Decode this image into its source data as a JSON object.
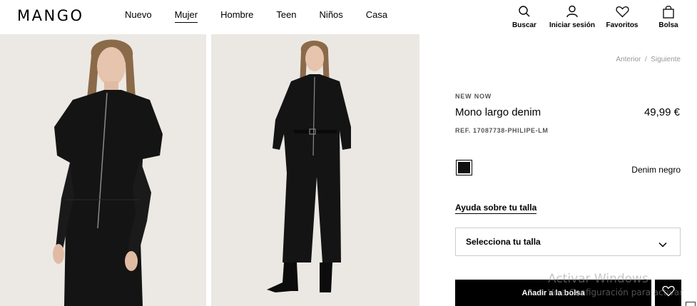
{
  "brand": {
    "logo": "MANGO"
  },
  "nav": {
    "items": [
      {
        "label": "Nuevo"
      },
      {
        "label": "Mujer",
        "active": true
      },
      {
        "label": "Hombre"
      },
      {
        "label": "Teen"
      },
      {
        "label": "Niños"
      },
      {
        "label": "Casa"
      }
    ]
  },
  "actions": {
    "search": {
      "label": "Buscar",
      "icon": "search-icon"
    },
    "login": {
      "label": "Iniciar sesión",
      "icon": "user-icon"
    },
    "favorites": {
      "label": "Favoritos",
      "icon": "heart-icon"
    },
    "bag": {
      "label": "Bolsa",
      "icon": "shopping-bag-icon"
    }
  },
  "pager": {
    "prev": "Anterior",
    "separator": "/",
    "next": "Siguiente"
  },
  "product": {
    "tag": "NEW NOW",
    "name": "Mono largo denim",
    "price": "49,99 €",
    "reference": "REF. 17087738-PHILIPE-LM",
    "color_name": "Denim negro",
    "color_hex": "#111111",
    "size_help": "Ayuda sobre tu talla",
    "size_select": "Selecciona tu talla",
    "add_to_bag": "Añadir a la bolsa"
  },
  "os_watermark": {
    "line1": "Activar Windows",
    "line2": "Ve a Configuración para activar"
  },
  "colors": {
    "accent": "#000000",
    "image_bg": "#ece9e4",
    "muted": "#999999"
  }
}
